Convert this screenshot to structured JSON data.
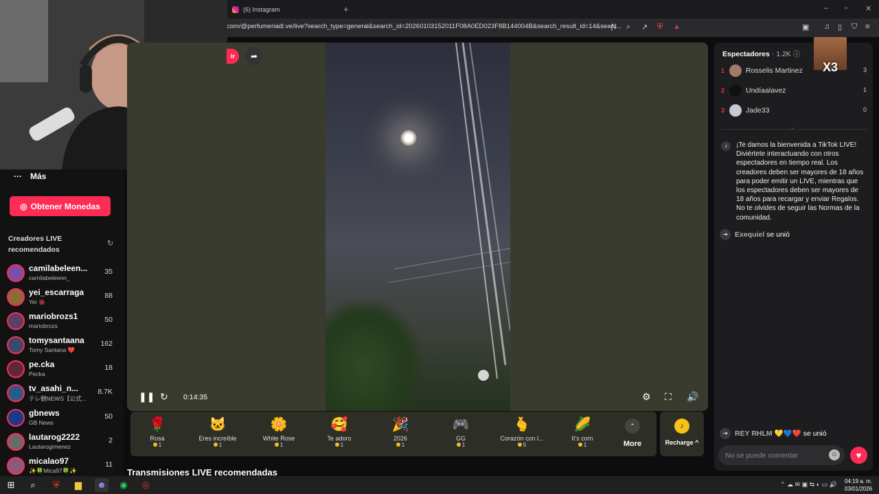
{
  "browser": {
    "tab_title": "(6) Instagram",
    "url": "com/@perfumeriadl.ve/live?search_type=general&search_id=20260103152011F08A0ED023F8B144004B&search_result_id=14&searc..."
  },
  "sidebar": {
    "more_label": "Más",
    "coins_button": "Obtener Monedas",
    "recommended_title": "Creadores LIVE recomendados",
    "creators": [
      {
        "name": "camilabeleen...",
        "handle": "camilabeleenn_",
        "count": "35"
      },
      {
        "name": "yei_escarraga",
        "handle": "Yei 🐞",
        "count": "88"
      },
      {
        "name": "mariobrozs1",
        "handle": "mariobrozs",
        "count": "50"
      },
      {
        "name": "tomysantaana",
        "handle": "Tomy Santana ❤️",
        "count": "162"
      },
      {
        "name": "pe.cka",
        "handle": "Pecka",
        "count": "18"
      },
      {
        "name": "tv_asahi_n...",
        "handle": "テレ朝NEWS【公式...",
        "count": "8.7K"
      },
      {
        "name": "gbnews",
        "handle": "GB News",
        "count": "50"
      },
      {
        "name": "lautarog2222",
        "handle": "Lautarogimenez",
        "count": "2"
      },
      {
        "name": "micalao97",
        "handle": "✨🍀Mica97🍀✨",
        "count": "11"
      }
    ]
  },
  "player": {
    "time": "0:14:35",
    "follow_label": "ir"
  },
  "gifts": [
    {
      "name": "Rosa",
      "price": "1",
      "icon": "🌹"
    },
    {
      "name": "Eres increíble",
      "price": "1",
      "icon": "🐱"
    },
    {
      "name": "White Rose",
      "price": "1",
      "icon": "🌼"
    },
    {
      "name": "Te adoro",
      "price": "1",
      "icon": "🥰"
    },
    {
      "name": "2026",
      "price": "1",
      "icon": "🎉"
    },
    {
      "name": "GG",
      "price": "1",
      "icon": "🎮"
    },
    {
      "name": "Corazón con l...",
      "price": "5",
      "icon": "🫰"
    },
    {
      "name": "It's corn",
      "price": "1",
      "icon": "🌽"
    }
  ],
  "more_label": "More",
  "recharge_label": "Recharge ^",
  "recommended_streams": "Transmisiones LIVE recomendadas",
  "panel": {
    "viewers_label": "Espectadores",
    "viewers_count": "· 1.2K",
    "meme_text": "X3",
    "viewers": [
      {
        "rank": "1",
        "name": "Rosselis Martinez",
        "score": "3"
      },
      {
        "rank": "2",
        "name": "Undíaalavez",
        "score": "1"
      },
      {
        "rank": "3",
        "name": "Jade33",
        "score": "0"
      }
    ],
    "welcome": "¡Te damos la bienvenida a TikTok LIVE! Diviértete interactuando con otros espectadores en tiempo real. Los creadores deben ser mayores de 18 años para poder emitir un LIVE, mientras que los espectadores deben ser mayores de 18 años para recargar y enviar Regalos. No te olvides de seguir las Normas de la comunidad.",
    "join1_user": "Exequiel",
    "join2_user": "REY RHLM 💛💙❤️",
    "joined_text": "se unió",
    "comment_placeholder": "No se puede comentar"
  },
  "taskbar": {
    "time": "04:19 a. m.",
    "date": "03/01/2026"
  }
}
